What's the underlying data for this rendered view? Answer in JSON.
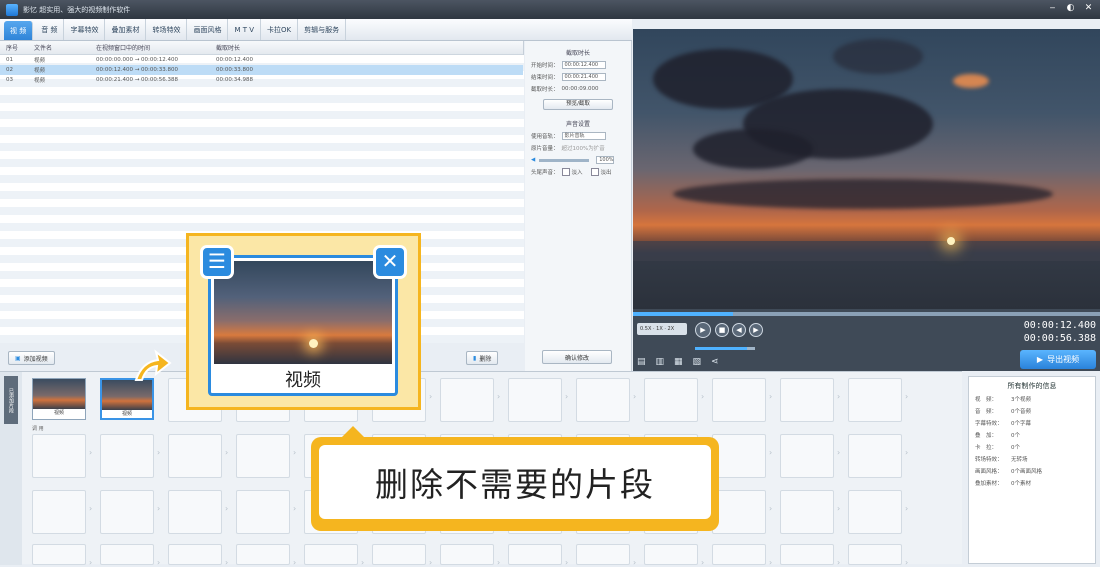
{
  "window": {
    "title": "影忆  超实用、强大的视频制作软件"
  },
  "tabs": [
    "视 频",
    "音 频",
    "字幕特效",
    "叠加素材",
    "转场特效",
    "画面风格",
    "M T V",
    "卡拉OK",
    "剪辑与服务"
  ],
  "clip_list": {
    "headers": [
      "序号",
      "文件名",
      "在视频窗口中的时间",
      "截取时长"
    ],
    "rows": [
      {
        "no": "01",
        "name": "视频",
        "range": "00:00:00.000 → 00:00:12.400",
        "dur": "00:00:12.400"
      },
      {
        "no": "02",
        "name": "视频",
        "range": "00:00:12.400 → 00:00:33.800",
        "dur": "00:00:33.800"
      },
      {
        "no": "03",
        "name": "视频",
        "range": "00:00:21.400 → 00:00:56.388",
        "dur": "00:00:34.988"
      }
    ],
    "add_button": "添加视频",
    "delete_button": "删除"
  },
  "clip_settings": {
    "section1": "截取时长",
    "start_label": "开始时间：",
    "start_value": "00:00:12.400",
    "end_label": "结束时间：",
    "end_value": "00:00:21.400",
    "dur_label": "截取时长：",
    "dur_value": "00:00:09.000",
    "pick_button": "预览/截取",
    "section2": "声音设置",
    "track_label": "使用音轨：",
    "track_value": "影片音轨",
    "vol_label": "原片音量：",
    "vol_note": "超过100%为扩音",
    "vol_value": "100%",
    "fade_label": "头尾声音：",
    "fade_in": "淡入",
    "fade_out": "淡出",
    "confirm_button": "确认修改"
  },
  "player": {
    "current": "00:00:12.400",
    "total": "00:00:56.388",
    "progress_fraction": 0.215
  },
  "export_button": "导出视频",
  "timeline": {
    "vertical_tab": "已添加片段",
    "row_label": "调 用",
    "clips": [
      {
        "label": "视频"
      },
      {
        "label": "视频"
      }
    ]
  },
  "info_panel": {
    "title": "所有制作的信息",
    "rows": [
      {
        "k": "视　频：",
        "v": "3个视频"
      },
      {
        "k": "音　频：",
        "v": "0个音频"
      },
      {
        "k": "字幕特效：",
        "v": "0个字幕"
      },
      {
        "k": "叠　加：",
        "v": "0个"
      },
      {
        "k": "卡　拉：",
        "v": "0个"
      },
      {
        "k": "转场特效：",
        "v": "无转场"
      },
      {
        "k": "画面风格：",
        "v": "0个画面风格"
      },
      {
        "k": "叠加素材：",
        "v": "0个素材"
      }
    ]
  },
  "popup": {
    "label": "视频"
  },
  "callout": {
    "text": "删除不需要的片段"
  },
  "colors": {
    "accent": "#2b8bdf",
    "highlight": "#f5b51f"
  }
}
